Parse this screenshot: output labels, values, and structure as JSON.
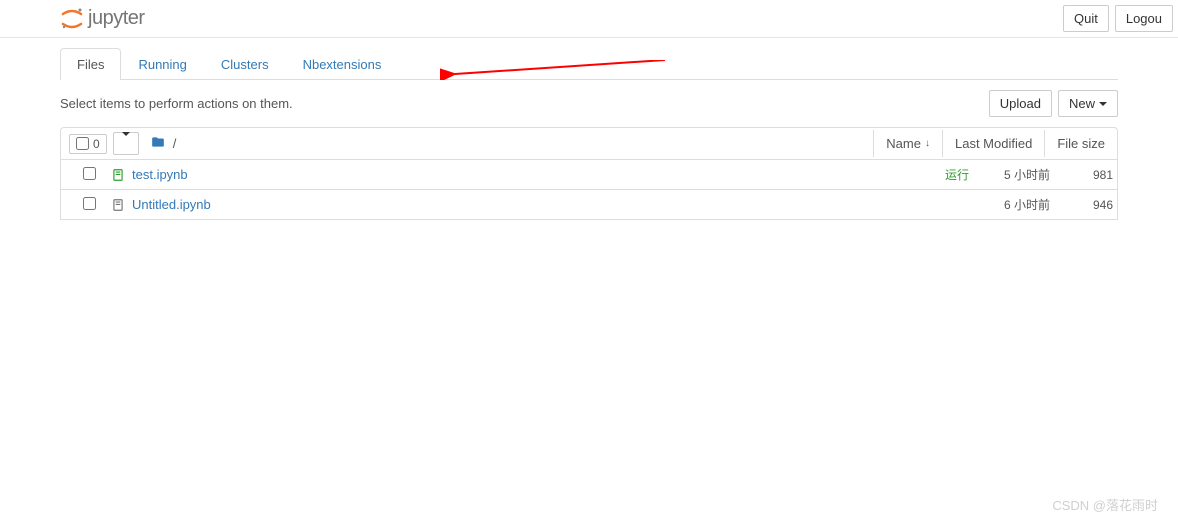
{
  "header": {
    "logo_text": "jupyter",
    "quit_label": "Quit",
    "logout_label": "Logou"
  },
  "tabs": {
    "items": [
      {
        "label": "Files",
        "active": true
      },
      {
        "label": "Running",
        "active": false
      },
      {
        "label": "Clusters",
        "active": false
      },
      {
        "label": "Nbextensions",
        "active": false
      }
    ]
  },
  "toolbar": {
    "select_text": "Select items to perform actions on them.",
    "upload_label": "Upload",
    "new_label": "New"
  },
  "list_header": {
    "select_count": "0",
    "breadcrumb": "/",
    "name_label": "Name",
    "modified_label": "Last Modified",
    "size_label": "File size"
  },
  "files": [
    {
      "name": "test.ipynb",
      "status": "运行",
      "modified": "5 小时前",
      "size": "981",
      "running": true
    },
    {
      "name": "Untitled.ipynb",
      "status": "",
      "modified": "6 小时前",
      "size": "946",
      "running": false
    }
  ],
  "watermark": "CSDN @落花雨时"
}
